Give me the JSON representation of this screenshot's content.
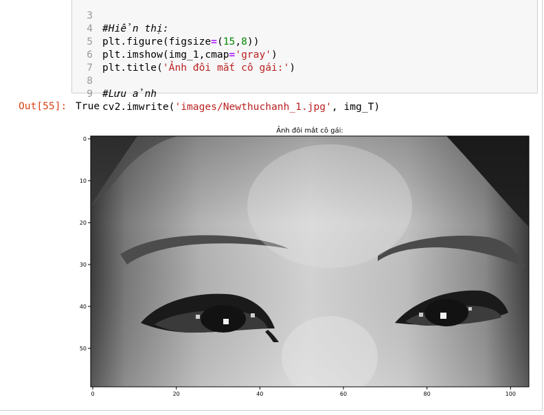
{
  "code_cell": {
    "lines": [
      {
        "number": "3",
        "text": "#Hiển thị:"
      },
      {
        "number": "4",
        "text": "plt.figure(figsize=(15,8))"
      },
      {
        "number": "5",
        "text": "plt.imshow(img_1,cmap='gray')"
      },
      {
        "number": "6",
        "text": "plt.title('Ảnh đôi mắt cô gái:')"
      },
      {
        "number": "7",
        "text": ""
      },
      {
        "number": "8",
        "text": "#Lưu ảnh"
      },
      {
        "number": "9",
        "text": "cv2.imwrite('images/Newthuchanh_1.jpg', img_T)"
      }
    ]
  },
  "output_cell": {
    "prompt": "Out[55]:",
    "value": "True"
  },
  "figure": {
    "title": "Ảnh đôi mắt cô gái:",
    "image_semantic": "grayscale-eyes-photo",
    "x_ticks": [
      "0",
      "20",
      "40",
      "60",
      "80",
      "100"
    ],
    "y_ticks": [
      "0",
      "10",
      "20",
      "30",
      "40",
      "50"
    ]
  }
}
